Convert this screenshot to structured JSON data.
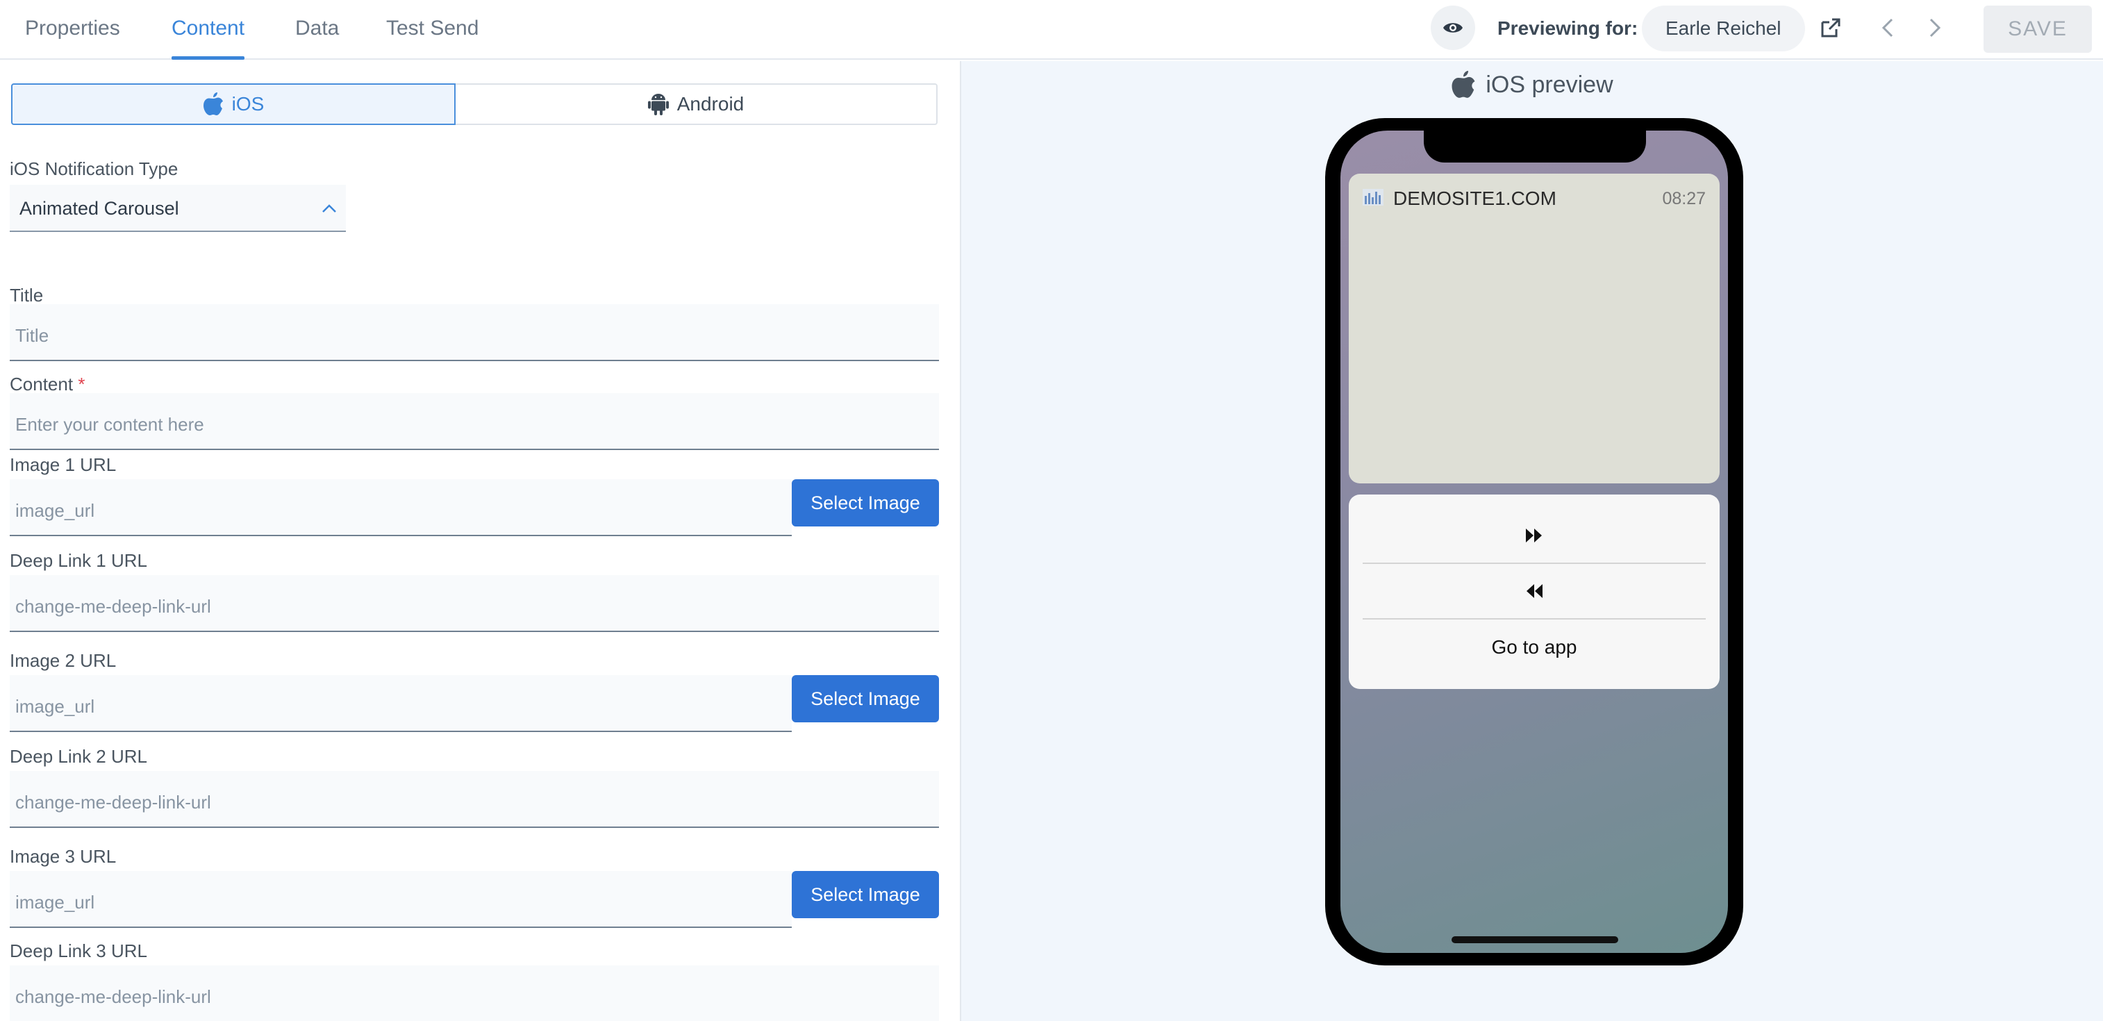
{
  "tabs": [
    {
      "label": "Properties"
    },
    {
      "label": "Content"
    },
    {
      "label": "Data"
    },
    {
      "label": "Test Send"
    }
  ],
  "header": {
    "previewing_label": "Previewing for:",
    "user_name": "Earle Reichel",
    "save_label": "SAVE"
  },
  "platforms": {
    "ios": "iOS",
    "android": "Android"
  },
  "form": {
    "notification_type_label": "iOS Notification Type",
    "notification_type_value": "Animated Carousel",
    "title_label": "Title",
    "title_placeholder": "Title",
    "content_label": "Content",
    "content_required": "*",
    "content_placeholder": "Enter your content here",
    "images": [
      {
        "image_label": "Image 1 URL",
        "image_placeholder": "image_url",
        "deep_label": "Deep Link 1 URL",
        "deep_placeholder": "change-me-deep-link-url"
      },
      {
        "image_label": "Image 2 URL",
        "image_placeholder": "image_url",
        "deep_label": "Deep Link 2 URL",
        "deep_placeholder": "change-me-deep-link-url"
      },
      {
        "image_label": "Image 3 URL",
        "image_placeholder": "image_url",
        "deep_label": "Deep Link 3 URL",
        "deep_placeholder": "change-me-deep-link-url"
      }
    ],
    "select_image_label": "Select Image"
  },
  "preview": {
    "title": "iOS preview",
    "app_name": "DEMOSITE1.COM",
    "time": "08:27",
    "actions": {
      "go_to_app": "Go to app"
    }
  },
  "colors": {
    "accent": "#3a85d9",
    "primary_button": "#2e73d6",
    "required": "#e0434e"
  }
}
